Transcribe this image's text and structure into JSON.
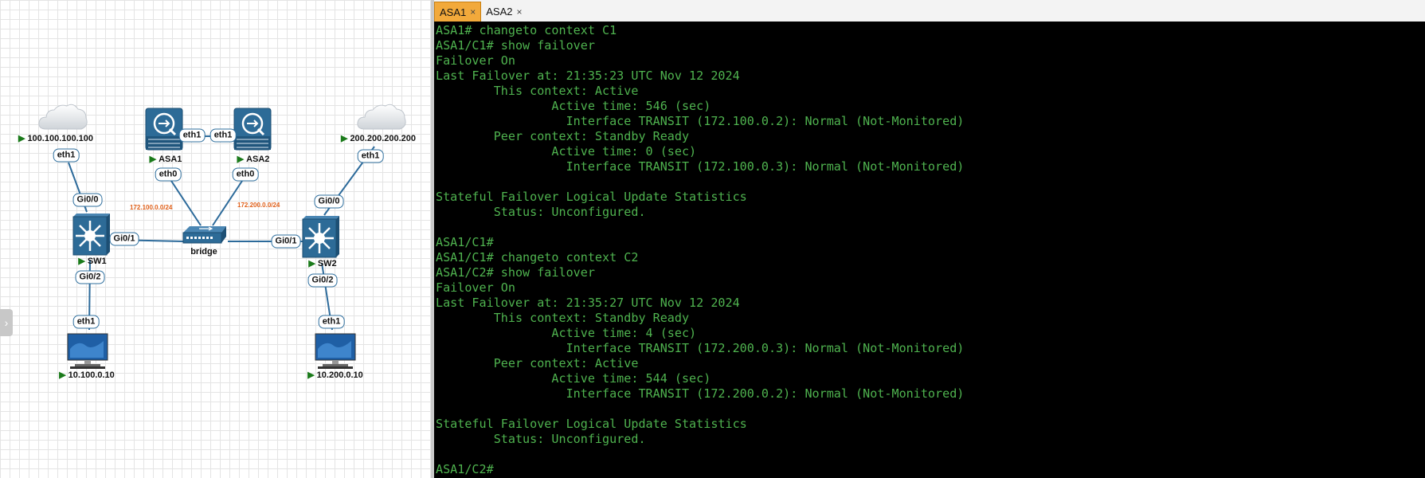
{
  "topology": {
    "nodes": {
      "cloud_left": {
        "label": "100.100.100.100"
      },
      "cloud_right": {
        "label": "200.200.200.200"
      },
      "asa1": {
        "label": "ASA1"
      },
      "asa2": {
        "label": "ASA2"
      },
      "sw1": {
        "label": "SW1"
      },
      "sw2": {
        "label": "SW2"
      },
      "bridge": {
        "label": "bridge"
      },
      "pc_left": {
        "label": "10.100.0.10"
      },
      "pc_right": {
        "label": "10.200.0.10"
      }
    },
    "ports": {
      "cloud_left_eth1": "eth1",
      "sw1_gi00": "Gi0/0",
      "sw1_gi01": "Gi0/1",
      "sw1_gi02": "Gi0/2",
      "pc_left_eth1": "eth1",
      "asa1_eth1": "eth1",
      "asa2_eth1": "eth1",
      "asa1_eth0": "eth0",
      "asa2_eth0": "eth0",
      "cloud_right_eth1": "eth1",
      "sw2_gi00": "Gi0/0",
      "sw2_gi01": "Gi0/1",
      "sw2_gi02": "Gi0/2",
      "pc_right_eth1": "eth1"
    },
    "subnets": {
      "left": "172.100.0.0/24",
      "right": "172.200.0.0/24"
    },
    "colors": {
      "link": "#2c6a9a",
      "subnet": "#e0601a",
      "running": "#1a7a1a"
    }
  },
  "tabs": [
    {
      "title": "ASA1",
      "close": "×",
      "active": true
    },
    {
      "title": "ASA2",
      "close": "×",
      "active": false
    }
  ],
  "terminal": {
    "lines": [
      "ASA1# changeto context C1",
      "ASA1/C1# show failover",
      "Failover On",
      "Last Failover at: 21:35:23 UTC Nov 12 2024",
      "        This context: Active",
      "                Active time: 546 (sec)",
      "                  Interface TRANSIT (172.100.0.2): Normal (Not-Monitored)",
      "        Peer context: Standby Ready",
      "                Active time: 0 (sec)",
      "                  Interface TRANSIT (172.100.0.3): Normal (Not-Monitored)",
      "",
      "Stateful Failover Logical Update Statistics",
      "        Status: Unconfigured.",
      "",
      "ASA1/C1#",
      "ASA1/C1# changeto context C2",
      "ASA1/C2# show failover",
      "Failover On",
      "Last Failover at: 21:35:27 UTC Nov 12 2024",
      "        This context: Standby Ready",
      "                Active time: 4 (sec)",
      "                  Interface TRANSIT (172.200.0.3): Normal (Not-Monitored)",
      "        Peer context: Active",
      "                Active time: 544 (sec)",
      "                  Interface TRANSIT (172.200.0.2): Normal (Not-Monitored)",
      "",
      "Stateful Failover Logical Update Statistics",
      "        Status: Unconfigured.",
      "",
      "ASA1/C2#"
    ],
    "colors": {
      "background": "#000000",
      "text": "#4fb34f"
    }
  }
}
